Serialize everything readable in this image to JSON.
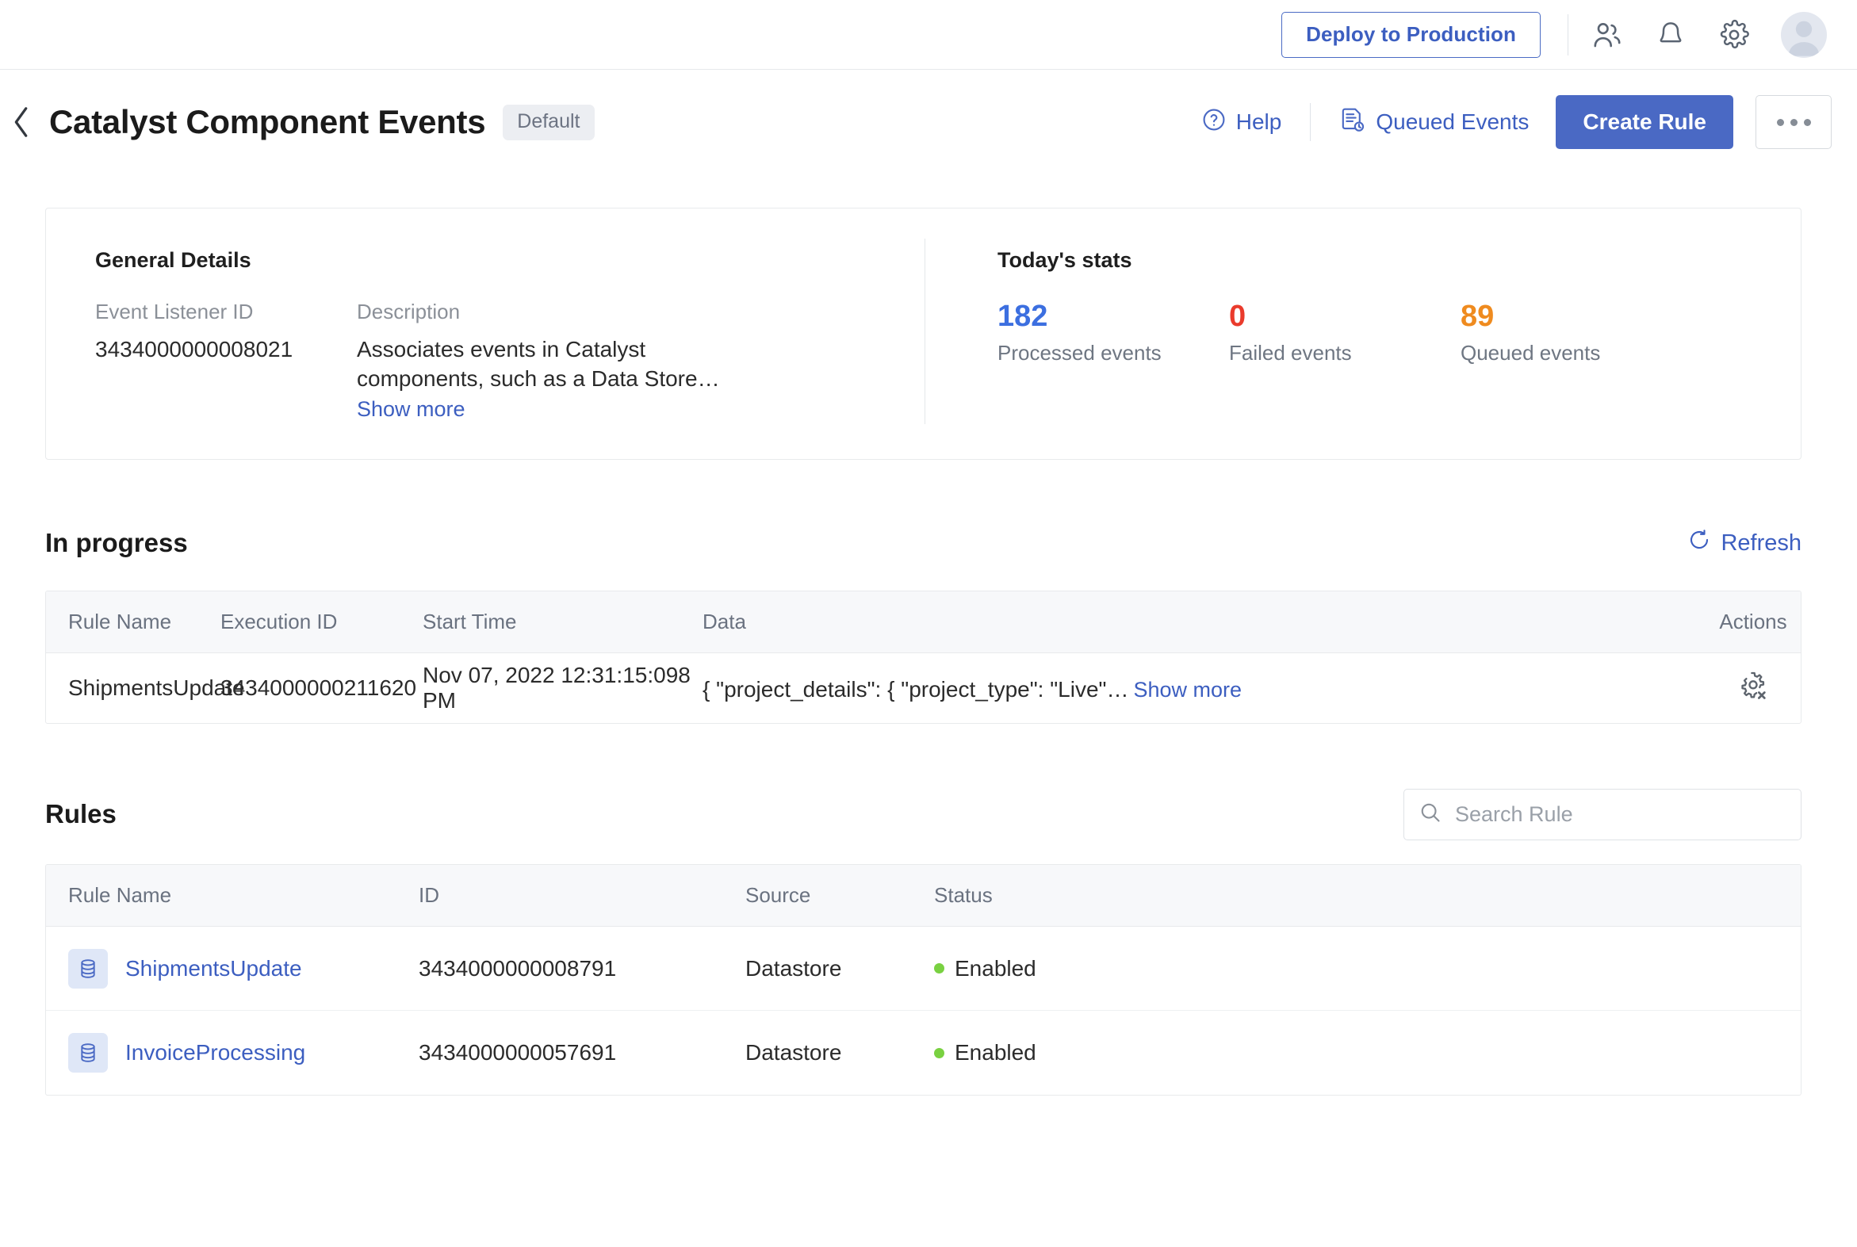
{
  "topbar": {
    "deploy_label": "Deploy to Production",
    "icons": [
      {
        "name": "users-icon"
      },
      {
        "name": "bell-icon"
      },
      {
        "name": "gear-icon"
      },
      {
        "name": "avatar"
      }
    ]
  },
  "header": {
    "back_icon": "chevron-left-icon",
    "title": "Catalyst Component Events",
    "badge": "Default",
    "help_label": "Help",
    "queued_events_label": "Queued Events",
    "create_rule_label": "Create Rule",
    "more_label": "..."
  },
  "general": {
    "section_title": "General Details",
    "listener_id_label": "Event Listener ID",
    "listener_id_value": "3434000000008021",
    "description_label": "Description",
    "description_value": "Associates events in Catalyst components, such as a Data Store…",
    "show_more": "Show more"
  },
  "stats": {
    "section_title": "Today's stats",
    "items": [
      {
        "value": "182",
        "label": "Processed events",
        "color": "#3c6fe0"
      },
      {
        "value": "0",
        "label": "Failed events",
        "color": "#ea3b2c"
      },
      {
        "value": "89",
        "label": "Queued events",
        "color": "#ef8b1f"
      }
    ]
  },
  "in_progress": {
    "title": "In progress",
    "refresh_label": "Refresh",
    "columns": [
      "Rule Name",
      "Execution ID",
      "Start Time",
      "Data",
      "Actions"
    ],
    "rows": [
      {
        "rule_name": "ShipmentsUpdate",
        "execution_id": "3434000000211620",
        "start_time": "Nov 07, 2022 12:31:15:098 PM",
        "data": "{ \"project_details\": { \"project_type\": \"Live\"…",
        "data_show_more": "Show more",
        "action_icon": "gear-cancel-icon"
      }
    ]
  },
  "rules": {
    "title": "Rules",
    "search_placeholder": "Search Rule",
    "search_value": "",
    "columns": [
      "Rule Name",
      "ID",
      "Source",
      "Status"
    ],
    "rows": [
      {
        "icon": "datastore-icon",
        "rule_name": "ShipmentsUpdate",
        "id": "3434000000008791",
        "source": "Datastore",
        "status": "Enabled"
      },
      {
        "icon": "datastore-icon",
        "rule_name": "InvoiceProcessing",
        "id": "3434000000057691",
        "source": "Datastore",
        "status": "Enabled"
      }
    ]
  },
  "colors": {
    "accent": "#4a69c4",
    "link": "#3c5ec0",
    "enabled_dot": "#79d141",
    "processed": "#3c6fe0",
    "failed": "#ea3b2c",
    "queued": "#ef8b1f"
  }
}
